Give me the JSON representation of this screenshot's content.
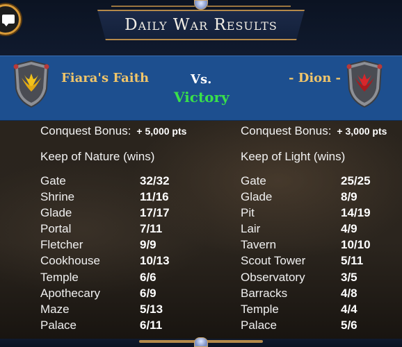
{
  "header": {
    "title": "Daily War Results",
    "chat_icon": "chat-bubble-icon"
  },
  "versus": {
    "left_team": "Fiara's Faith",
    "vs_label": "Vs.",
    "result": "Victory",
    "right_team": "- Dion -",
    "left_crest_color": "#f2c21a",
    "right_crest_color": "#d8262b",
    "band_color": "#1d4f8f",
    "result_color": "#39e14a",
    "team_name_color": "#f0c56a"
  },
  "left": {
    "bonus_label": "Conquest Bonus:",
    "bonus_value": "+ 5,000 pts",
    "keep_title": "Keep of Nature (wins)",
    "rows": [
      {
        "name": "Gate",
        "score": "32/32"
      },
      {
        "name": "Shrine",
        "score": "11/16"
      },
      {
        "name": "Glade",
        "score": "17/17"
      },
      {
        "name": "Portal",
        "score": "7/11"
      },
      {
        "name": "Fletcher",
        "score": "9/9"
      },
      {
        "name": "Cookhouse",
        "score": "10/13"
      },
      {
        "name": "Temple",
        "score": "6/6"
      },
      {
        "name": "Apothecary",
        "score": "6/9"
      },
      {
        "name": "Maze",
        "score": "5/13"
      },
      {
        "name": "Palace",
        "score": "6/11"
      }
    ]
  },
  "right": {
    "bonus_label": "Conquest Bonus:",
    "bonus_value": "+ 3,000 pts",
    "keep_title": "Keep of Light (wins)",
    "rows": [
      {
        "name": "Gate",
        "score": "25/25"
      },
      {
        "name": "Glade",
        "score": "8/9"
      },
      {
        "name": "Pit",
        "score": "14/19"
      },
      {
        "name": "Lair",
        "score": "4/9"
      },
      {
        "name": "Tavern",
        "score": "10/10"
      },
      {
        "name": "Scout Tower",
        "score": "5/11"
      },
      {
        "name": "Observatory",
        "score": "3/5"
      },
      {
        "name": "Barracks",
        "score": "4/8"
      },
      {
        "name": "Temple",
        "score": "4/4"
      },
      {
        "name": "Palace",
        "score": "5/6"
      }
    ]
  }
}
